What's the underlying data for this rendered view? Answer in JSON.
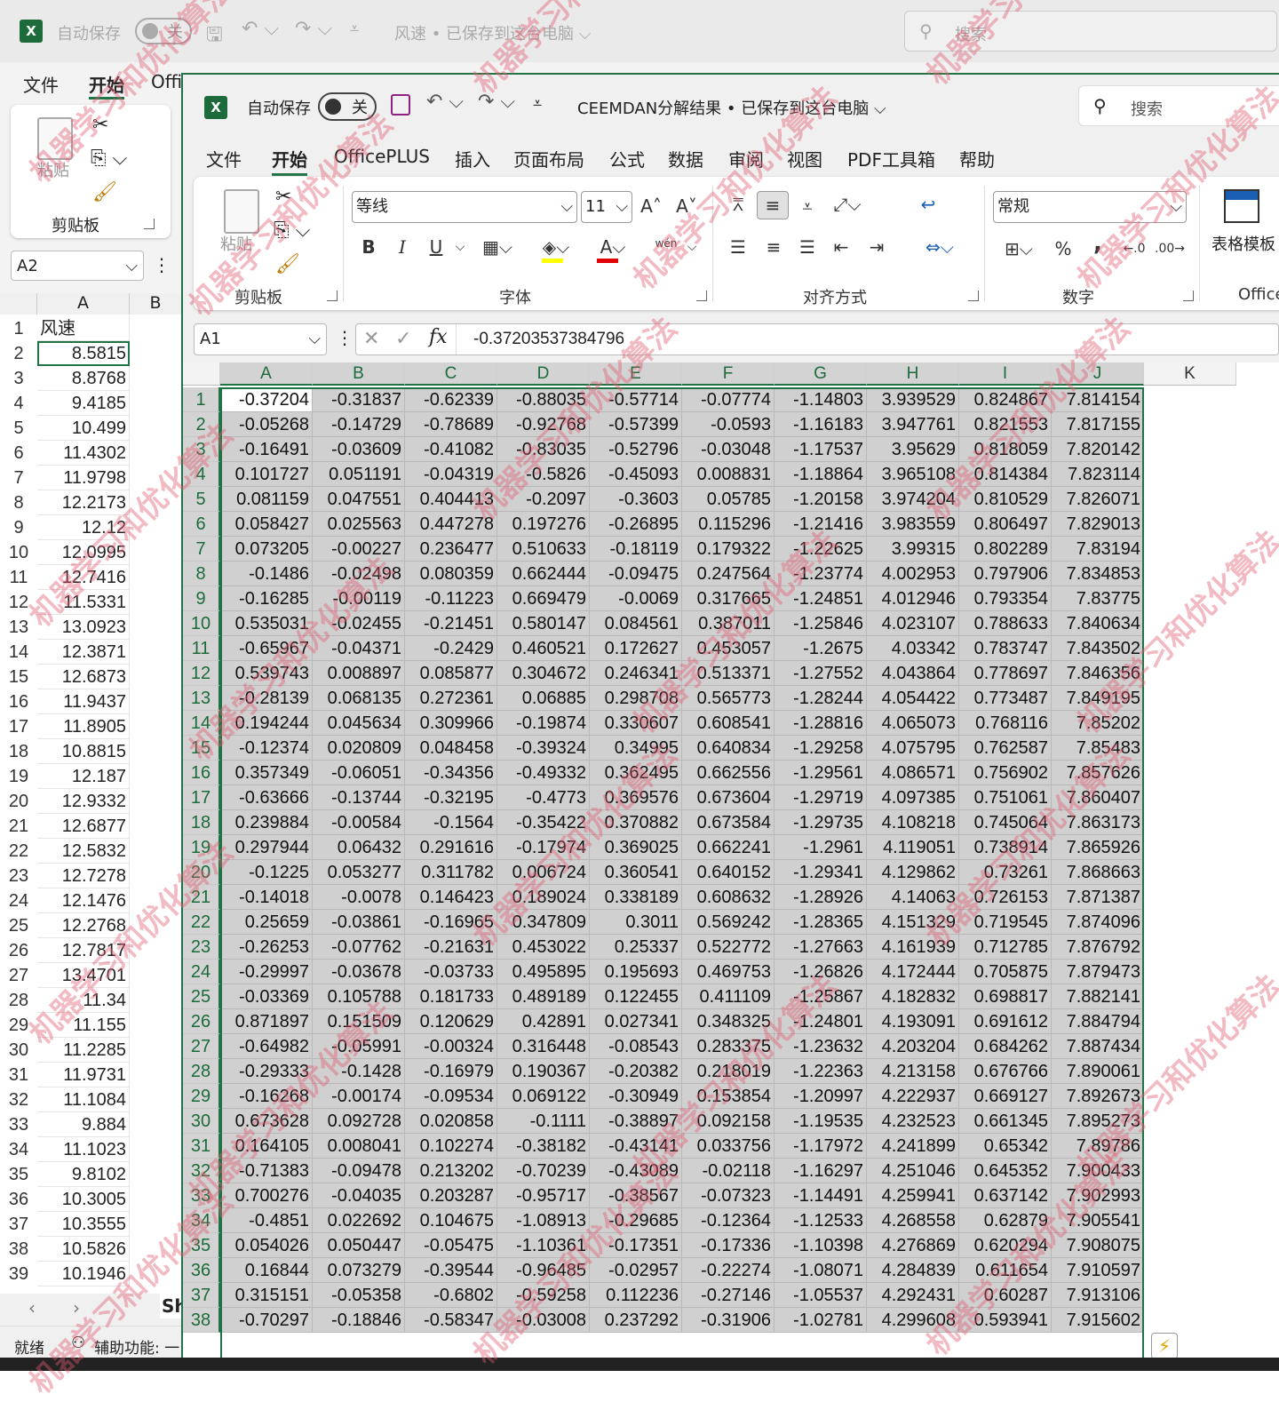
{
  "background_window": {
    "autosave_label": "自动保存",
    "toggle_label": "关",
    "title": "风速 • 已保存到这台电脑 ⌵",
    "search_placeholder": "搜索",
    "menu": [
      "文件",
      "开始",
      "Offi"
    ],
    "clipboard_group": "剪贴板",
    "paste_label": "粘贴",
    "name_box": "A2",
    "column_a_header": "A",
    "column_b_header": "B",
    "sheet_tab": "Sh",
    "status_ready": "就绪",
    "status_accessibility": "辅助功能: 一",
    "rows": [
      [
        "1",
        "风速"
      ],
      [
        "2",
        "8.5815"
      ],
      [
        "3",
        "8.8768"
      ],
      [
        "4",
        "9.4185"
      ],
      [
        "5",
        "10.499"
      ],
      [
        "6",
        "11.4302"
      ],
      [
        "7",
        "11.9798"
      ],
      [
        "8",
        "12.2173"
      ],
      [
        "9",
        "12.12"
      ],
      [
        "10",
        "12.0995"
      ],
      [
        "11",
        "12.7416"
      ],
      [
        "12",
        "11.5331"
      ],
      [
        "13",
        "13.0923"
      ],
      [
        "14",
        "12.3871"
      ],
      [
        "15",
        "12.6873"
      ],
      [
        "16",
        "11.9437"
      ],
      [
        "17",
        "11.8905"
      ],
      [
        "18",
        "10.8815"
      ],
      [
        "19",
        "12.187"
      ],
      [
        "20",
        "12.9332"
      ],
      [
        "21",
        "12.6877"
      ],
      [
        "22",
        "12.5832"
      ],
      [
        "23",
        "12.7278"
      ],
      [
        "24",
        "12.1476"
      ],
      [
        "25",
        "12.2768"
      ],
      [
        "26",
        "12.7817"
      ],
      [
        "27",
        "13.4701"
      ],
      [
        "28",
        "11.34"
      ],
      [
        "29",
        "11.155"
      ],
      [
        "30",
        "11.2285"
      ],
      [
        "31",
        "11.9731"
      ],
      [
        "32",
        "11.1084"
      ],
      [
        "33",
        "9.884"
      ],
      [
        "34",
        "11.1023"
      ],
      [
        "35",
        "9.8102"
      ],
      [
        "36",
        "10.3005"
      ],
      [
        "37",
        "10.3555"
      ],
      [
        "38",
        "10.5826"
      ],
      [
        "39",
        "10.1946"
      ]
    ]
  },
  "window": {
    "autosave_label": "自动保存",
    "toggle_label": "关",
    "title": "CEEMDAN分解结果 • 已保存到这台电脑",
    "search_placeholder": "搜索",
    "menu": [
      "文件",
      "开始",
      "OfficePLUS",
      "插入",
      "页面布局",
      "公式",
      "数据",
      "审阅",
      "视图",
      "PDF工具箱",
      "帮助"
    ],
    "ribbon": {
      "paste_label": "粘贴",
      "clipboard_group": "剪贴板",
      "font_name": "等线",
      "font_size": "11",
      "bold": "B",
      "italic": "I",
      "underline": "U",
      "font_group": "字体",
      "phonetic": "wén",
      "align_group": "对齐方式",
      "number_format": "常规",
      "percent": "%",
      "comma": ",",
      "number_group": "数字",
      "table_template": "表格模板",
      "office_group": "Office"
    },
    "name_box": "A1",
    "formula_value": "-0.37203537384796",
    "fx": "fx"
  },
  "sheet": {
    "columns": [
      "A",
      "B",
      "C",
      "D",
      "E",
      "F",
      "G",
      "H",
      "I",
      "J",
      "K"
    ],
    "rows": [
      [
        "1",
        "-0.37204",
        "-0.31837",
        "-0.62339",
        "-0.88035",
        "-0.57714",
        "-0.07774",
        "-1.14803",
        "3.939529",
        "0.824867",
        "7.814154"
      ],
      [
        "2",
        "-0.05268",
        "-0.14729",
        "-0.78689",
        "-0.92768",
        "-0.57399",
        "-0.0593",
        "-1.16183",
        "3.947761",
        "0.821553",
        "7.817155"
      ],
      [
        "3",
        "-0.16491",
        "-0.03609",
        "-0.41082",
        "-0.83035",
        "-0.52796",
        "-0.03048",
        "-1.17537",
        "3.95629",
        "0.818059",
        "7.820142"
      ],
      [
        "4",
        "0.101727",
        "0.051191",
        "-0.04319",
        "-0.5826",
        "-0.45093",
        "0.008831",
        "-1.18864",
        "3.965108",
        "0.814384",
        "7.823114"
      ],
      [
        "5",
        "0.081159",
        "0.047551",
        "0.404413",
        "-0.2097",
        "-0.3603",
        "0.05785",
        "-1.20158",
        "3.974204",
        "0.810529",
        "7.826071"
      ],
      [
        "6",
        "0.058427",
        "0.025563",
        "0.447278",
        "0.197276",
        "-0.26895",
        "0.115296",
        "-1.21416",
        "3.983559",
        "0.806497",
        "7.829013"
      ],
      [
        "7",
        "0.073205",
        "-0.00227",
        "0.236477",
        "0.510633",
        "-0.18119",
        "0.179322",
        "-1.22625",
        "3.99315",
        "0.802289",
        "7.83194"
      ],
      [
        "8",
        "-0.1486",
        "-0.02498",
        "0.080359",
        "0.662444",
        "-0.09475",
        "0.247564",
        "-1.23774",
        "4.002953",
        "0.797906",
        "7.834853"
      ],
      [
        "9",
        "-0.16285",
        "-0.00119",
        "-0.11223",
        "0.669479",
        "-0.0069",
        "0.317665",
        "-1.24851",
        "4.012946",
        "0.793354",
        "7.83775"
      ],
      [
        "10",
        "0.535031",
        "-0.02455",
        "-0.21451",
        "0.580147",
        "0.084561",
        "0.387011",
        "-1.25846",
        "4.023107",
        "0.788633",
        "7.840634"
      ],
      [
        "11",
        "-0.65967",
        "-0.04371",
        "-0.2429",
        "0.460521",
        "0.172627",
        "0.453057",
        "-1.2675",
        "4.03342",
        "0.783747",
        "7.843502"
      ],
      [
        "12",
        "0.539743",
        "0.008897",
        "0.085877",
        "0.304672",
        "0.246341",
        "0.513371",
        "-1.27552",
        "4.043864",
        "0.778697",
        "7.846356"
      ],
      [
        "13",
        "-0.28139",
        "0.068135",
        "0.272361",
        "0.06885",
        "0.298708",
        "0.565773",
        "-1.28244",
        "4.054422",
        "0.773487",
        "7.849195"
      ],
      [
        "14",
        "0.194244",
        "0.045634",
        "0.309966",
        "-0.19874",
        "0.330607",
        "0.608541",
        "-1.28816",
        "4.065073",
        "0.768116",
        "7.85202"
      ],
      [
        "15",
        "-0.12374",
        "0.020809",
        "0.048458",
        "-0.39324",
        "0.34995",
        "0.640834",
        "-1.29258",
        "4.075795",
        "0.762587",
        "7.85483"
      ],
      [
        "16",
        "0.357349",
        "-0.06051",
        "-0.34356",
        "-0.49332",
        "0.362495",
        "0.662556",
        "-1.29561",
        "4.086571",
        "0.756902",
        "7.857626"
      ],
      [
        "17",
        "-0.63666",
        "-0.13744",
        "-0.32195",
        "-0.4773",
        "0.369576",
        "0.673604",
        "-1.29719",
        "4.097385",
        "0.751061",
        "7.860407"
      ],
      [
        "18",
        "0.239884",
        "-0.00584",
        "-0.1564",
        "-0.35422",
        "0.370882",
        "0.673584",
        "-1.29735",
        "4.108218",
        "0.745064",
        "7.863173"
      ],
      [
        "19",
        "0.297944",
        "0.06432",
        "0.291616",
        "-0.17974",
        "0.369025",
        "0.662241",
        "-1.2961",
        "4.119051",
        "0.738914",
        "7.865926"
      ],
      [
        "20",
        "-0.1225",
        "0.053277",
        "0.311782",
        "0.006724",
        "0.360541",
        "0.640152",
        "-1.29341",
        "4.129862",
        "0.73261",
        "7.868663"
      ],
      [
        "21",
        "-0.14018",
        "-0.0078",
        "0.146423",
        "0.189024",
        "0.338189",
        "0.608632",
        "-1.28926",
        "4.14063",
        "0.726153",
        "7.871387"
      ],
      [
        "22",
        "0.25659",
        "-0.03861",
        "-0.16965",
        "0.347809",
        "0.3011",
        "0.569242",
        "-1.28365",
        "4.151329",
        "0.719545",
        "7.874096"
      ],
      [
        "23",
        "-0.26253",
        "-0.07762",
        "-0.21631",
        "0.453022",
        "0.25337",
        "0.522772",
        "-1.27663",
        "4.161939",
        "0.712785",
        "7.876792"
      ],
      [
        "24",
        "-0.29997",
        "-0.03678",
        "-0.03733",
        "0.495895",
        "0.195693",
        "0.469753",
        "-1.26826",
        "4.172444",
        "0.705875",
        "7.879473"
      ],
      [
        "25",
        "-0.03369",
        "0.105788",
        "0.181733",
        "0.489189",
        "0.122455",
        "0.411109",
        "-1.25867",
        "4.182832",
        "0.698817",
        "7.882141"
      ],
      [
        "26",
        "0.871897",
        "0.151509",
        "0.120629",
        "0.42891",
        "0.027341",
        "0.348325",
        "-1.24801",
        "4.193091",
        "0.691612",
        "7.884794"
      ],
      [
        "27",
        "-0.64982",
        "-0.05991",
        "-0.00324",
        "0.316448",
        "-0.08543",
        "0.283375",
        "-1.23632",
        "4.203204",
        "0.684262",
        "7.887434"
      ],
      [
        "28",
        "-0.29333",
        "-0.1428",
        "-0.16979",
        "0.190367",
        "-0.20382",
        "0.218019",
        "-1.22363",
        "4.213158",
        "0.676766",
        "7.890061"
      ],
      [
        "29",
        "-0.16268",
        "-0.00174",
        "-0.09534",
        "0.069122",
        "-0.30949",
        "0.153854",
        "-1.20997",
        "4.222937",
        "0.669127",
        "7.892673"
      ],
      [
        "30",
        "0.673628",
        "0.092728",
        "0.020858",
        "-0.1111",
        "-0.38897",
        "0.092158",
        "-1.19535",
        "4.232523",
        "0.661345",
        "7.895273"
      ],
      [
        "31",
        "0.164105",
        "0.008041",
        "0.102274",
        "-0.38182",
        "-0.43141",
        "0.033756",
        "-1.17972",
        "4.241899",
        "0.65342",
        "7.89786"
      ],
      [
        "32",
        "-0.71383",
        "-0.09478",
        "0.213202",
        "-0.70239",
        "-0.43089",
        "-0.02118",
        "-1.16297",
        "4.251046",
        "0.645352",
        "7.900433"
      ],
      [
        "33",
        "0.700276",
        "-0.04035",
        "0.203287",
        "-0.95717",
        "-0.38567",
        "-0.07323",
        "-1.14491",
        "4.259941",
        "0.637142",
        "7.902993"
      ],
      [
        "34",
        "-0.4851",
        "0.022692",
        "0.104675",
        "-1.08913",
        "-0.29685",
        "-0.12364",
        "-1.12533",
        "4.268558",
        "0.62879",
        "7.905541"
      ],
      [
        "35",
        "0.054026",
        "0.050447",
        "-0.05475",
        "-1.10361",
        "-0.17351",
        "-0.17336",
        "-1.10398",
        "4.276869",
        "0.620294",
        "7.908075"
      ],
      [
        "36",
        "0.16844",
        "0.073279",
        "-0.39544",
        "-0.96485",
        "-0.02957",
        "-0.22274",
        "-1.08071",
        "4.284839",
        "0.611654",
        "7.910597"
      ],
      [
        "37",
        "0.315151",
        "-0.05358",
        "-0.6802",
        "-0.59258",
        "0.112236",
        "-0.27146",
        "-1.05537",
        "4.292431",
        "0.60287",
        "7.913106"
      ],
      [
        "38",
        "-0.70297",
        "-0.18846",
        "-0.58347",
        "-0.03008",
        "0.237292",
        "-0.31906",
        "-1.02781",
        "4.299608",
        "0.593941",
        "7.915602"
      ]
    ]
  },
  "watermark": "机器学习和优化算法",
  "colors": {
    "excel_green": "#217346",
    "selection_gray": "#d0d0d0",
    "watermark": "#e15a6e"
  }
}
